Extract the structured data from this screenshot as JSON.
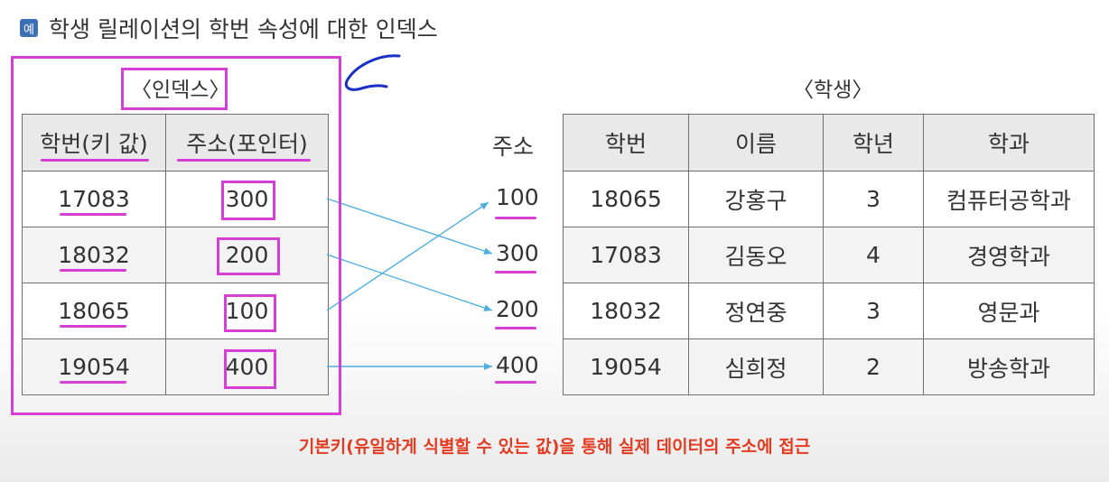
{
  "header": {
    "badge": "예",
    "title": "학생 릴레이션의 학번 속성에 대한 인덱스"
  },
  "index_table": {
    "caption": "〈인덱스〉",
    "headers": [
      "학번(키 값)",
      "주소(포인터)"
    ],
    "rows": [
      {
        "key": "17083",
        "pointer": "300"
      },
      {
        "key": "18032",
        "pointer": "200"
      },
      {
        "key": "18065",
        "pointer": "100"
      },
      {
        "key": "19054",
        "pointer": "400"
      }
    ]
  },
  "address_column": {
    "header": "주소",
    "values": [
      "100",
      "300",
      "200",
      "400"
    ]
  },
  "student_table": {
    "caption": "〈학생〉",
    "headers": [
      "학번",
      "이름",
      "학년",
      "학과"
    ],
    "rows": [
      [
        "18065",
        "강홍구",
        "3",
        "컴퓨터공학과"
      ],
      [
        "17083",
        "김동오",
        "4",
        "경영학과"
      ],
      [
        "18032",
        "정연중",
        "3",
        "영문과"
      ],
      [
        "19054",
        "심희정",
        "2",
        "방송학과"
      ]
    ]
  },
  "footer": "기본키(유일하게 식별할 수 있는 값)을 통해 실제 데이터의 주소에 접근",
  "colors": {
    "annotation": "#d63fd6",
    "arrow": "#4fb0e0",
    "footer": "#e23c22",
    "ink": "#1a2fc8"
  }
}
